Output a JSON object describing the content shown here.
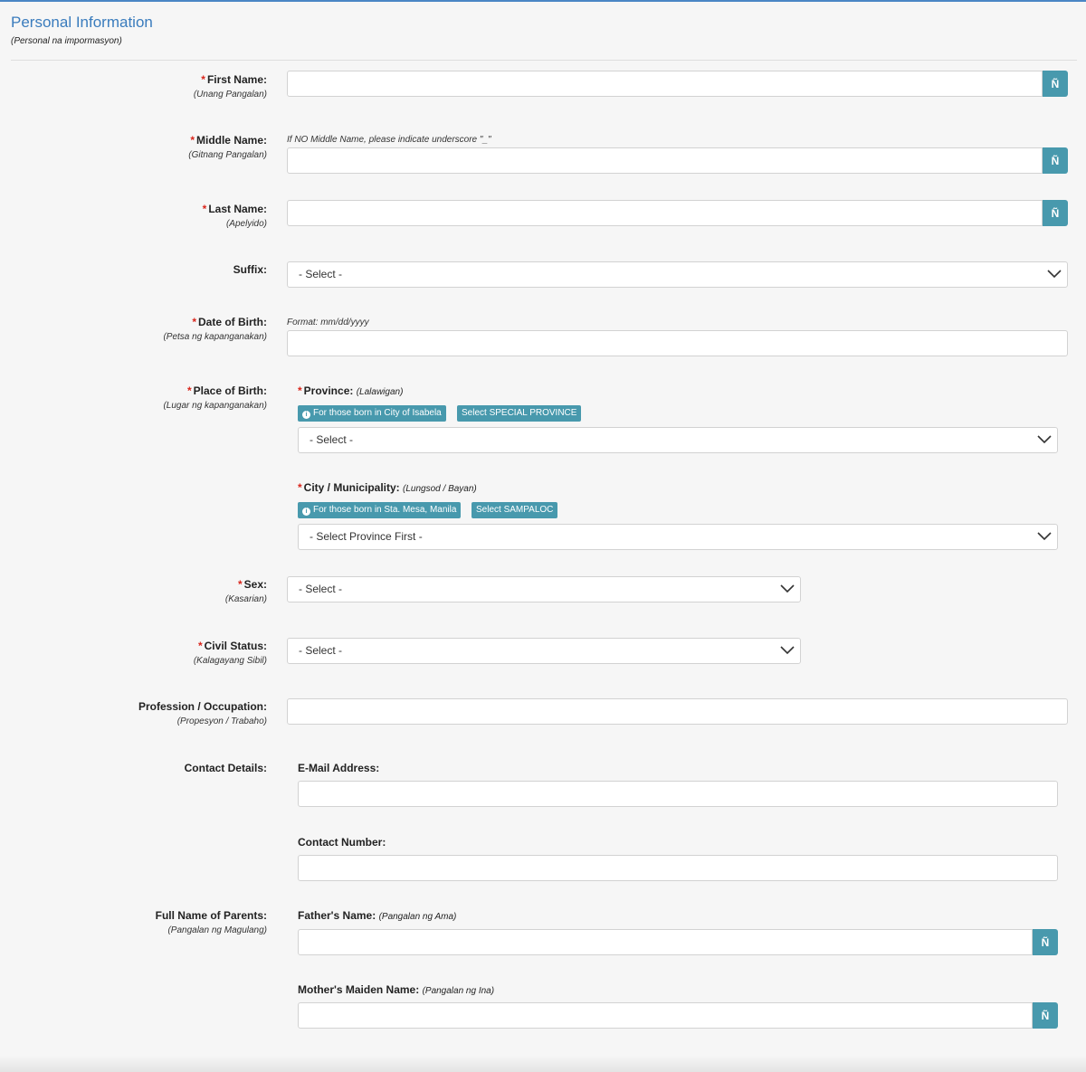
{
  "header": {
    "title": "Personal Information",
    "subtitle": "(Personal na impormasyon)"
  },
  "labels": {
    "first_name": "First Name:",
    "first_name_sub": "(Unang Pangalan)",
    "middle_name": "Middle Name:",
    "middle_name_sub": "(Gitnang Pangalan)",
    "last_name": "Last Name:",
    "last_name_sub": "(Apelyido)",
    "suffix": "Suffix:",
    "dob": "Date of Birth:",
    "dob_sub": "(Petsa ng kapanganakan)",
    "pob": "Place of Birth:",
    "pob_sub": "(Lugar ng kapanganakan)",
    "sex": "Sex:",
    "sex_sub": "(Kasarian)",
    "civil_status": "Civil Status:",
    "civil_status_sub": "(Kalagayang Sibil)",
    "profession": "Profession / Occupation:",
    "profession_sub": "(Propesyon / Trabaho)",
    "contact": "Contact Details:",
    "parents": "Full Name of Parents:",
    "parents_sub": "(Pangalan ng Magulang)"
  },
  "required_mark": "*",
  "n_tilde_label": "Ñ",
  "notes": {
    "middle_name": "If NO Middle Name, please indicate underscore \"_\"",
    "dob_format": "Format: mm/dd/yyyy"
  },
  "place_of_birth": {
    "province_label": "Province:",
    "province_sub": "(Lalawigan)",
    "province_info_badge": "For those born in City of Isabela",
    "province_special_button": "Select SPECIAL PROVINCE",
    "province_select": "- Select -",
    "city_label": "City / Municipality:",
    "city_sub": "(Lungsod / Bayan)",
    "city_info_badge": "For those born in Sta. Mesa, Manila",
    "city_special_button": "Select SAMPALOC",
    "city_select": "- Select Province First -"
  },
  "selects": {
    "suffix": "- Select -",
    "sex": "- Select -",
    "civil_status": "- Select -"
  },
  "contact": {
    "email_label": "E-Mail Address:",
    "phone_label": "Contact Number:"
  },
  "parents": {
    "father_label": "Father's Name:",
    "father_sub": "(Pangalan ng Ama)",
    "mother_label": "Mother's Maiden Name:",
    "mother_sub": "(Pangalan ng Ina)"
  },
  "values": {
    "first_name": "",
    "middle_name": "",
    "last_name": "",
    "dob": "",
    "profession": "",
    "email": "",
    "phone": "",
    "father": "",
    "mother": ""
  },
  "colors": {
    "title": "#3a7cbd",
    "accent_button": "#4899ad",
    "required": "#d9261c"
  },
  "icons": {
    "chevron": "chevron-down-icon",
    "info": "info-circle-icon"
  }
}
